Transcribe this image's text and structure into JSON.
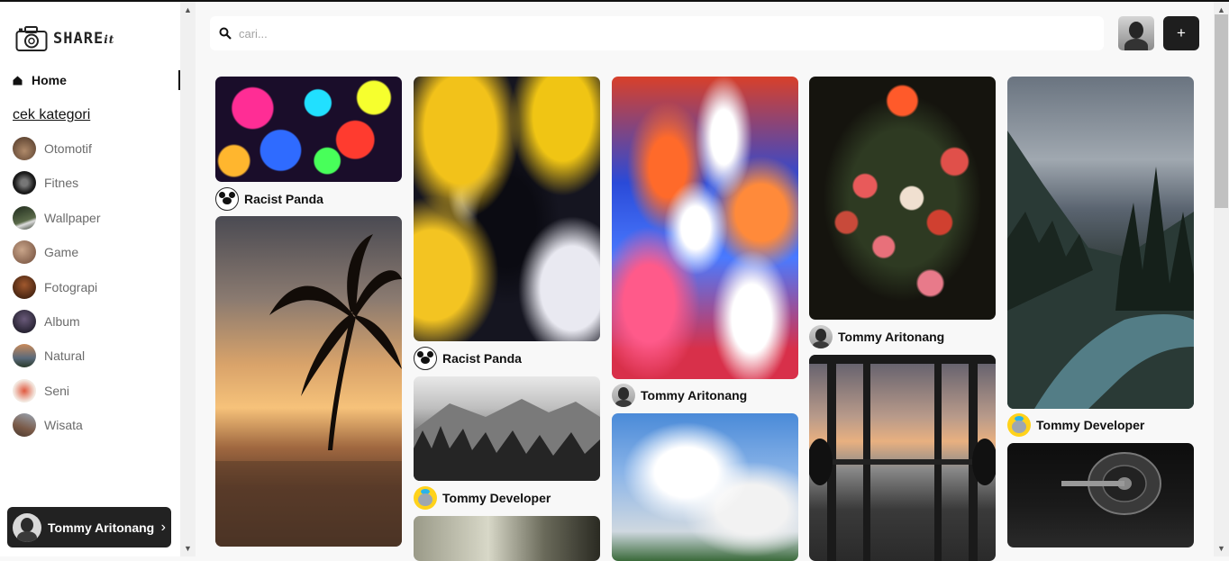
{
  "app": {
    "name": "SHARE",
    "name_suffix": "it"
  },
  "sidebar": {
    "home_label": "Home",
    "category_heading": "cek kategori",
    "categories": [
      {
        "label": "Otomotif",
        "color": "#7a5a44"
      },
      {
        "label": "Fitnes",
        "color": "#2b2b2b"
      },
      {
        "label": "Wallpaper",
        "color": "#3d4a38"
      },
      {
        "label": "Game",
        "color": "#8a6a55"
      },
      {
        "label": "Fotograpi",
        "color": "#5a3522"
      },
      {
        "label": "Album",
        "color": "#1f1f2b"
      },
      {
        "label": "Natural",
        "color": "#8a5a3a"
      },
      {
        "label": "Seni",
        "color": "#c04a3a"
      },
      {
        "label": "Wisata",
        "color": "#7a6a60"
      }
    ],
    "user_card": {
      "name": "Tommy Aritonang"
    }
  },
  "header": {
    "search_placeholder": "cari...",
    "add_label": "+"
  },
  "pins": {
    "p1": {
      "user": "Racist Panda"
    },
    "p2": {
      "user": "Racist Panda"
    },
    "p3": {
      "user": "Tommy Developer"
    },
    "p4": {
      "user": "Tommy Aritonang"
    },
    "p5": {
      "user": "Tommy Aritonang"
    },
    "p6": {
      "user": "Tommy Developer"
    }
  },
  "colors": {
    "accent_dark": "#1e1e1e",
    "background": "#f8f8f8"
  }
}
